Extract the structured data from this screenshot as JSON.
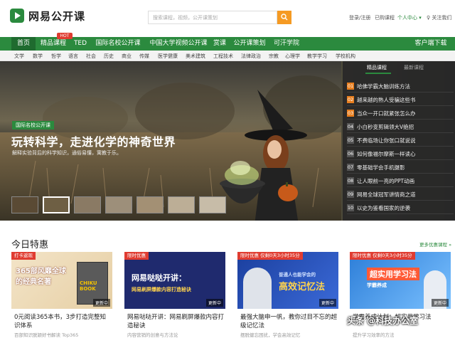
{
  "header": {
    "logo_text": "网易公开课",
    "search_placeholder": "搜索课程，视频，公开课策划",
    "links": [
      "登录/注册",
      "已购课程",
      "个人中心 ▾",
      "关注我们"
    ]
  },
  "nav": {
    "items": [
      "首页",
      "精品课程",
      "TED",
      "国际名校公开课",
      "中国大学视频公开课",
      "赏课",
      "公开课策划",
      "可汗学院"
    ],
    "hot_badge": "HOT",
    "client_download": "客户端下载"
  },
  "subnav": [
    "文学",
    "数学",
    "哲学",
    "语言",
    "社会",
    "历史",
    "商业",
    "传媒",
    "医学健康",
    "美术建筑",
    "工程技术",
    "法律政治",
    "宗教",
    "心理学",
    "教学学习",
    "学校机构"
  ],
  "banner": {
    "tag": "国际名校公开课",
    "title": "玩转科学，走进化学的神奇世界",
    "subtitle": "解释实验背后的科学知识，通俗易懂，寓教于乐。"
  },
  "side": {
    "tabs": [
      "精品课程",
      "最新课程"
    ],
    "items": [
      {
        "num": "01",
        "text": "哈佛学霸大脑训练方法"
      },
      {
        "num": "02",
        "text": "越来越的熟人受骗这些书"
      },
      {
        "num": "03",
        "text": "当众一开口就紧张怎么办"
      },
      {
        "num": "04",
        "text": "小白秒变剪辑领大V绝招"
      },
      {
        "num": "05",
        "text": "不费临场让你张口就说说"
      },
      {
        "num": "06",
        "text": "如何像福尔摩斯一样读心"
      },
      {
        "num": "07",
        "text": "零基础学会手机摄影"
      },
      {
        "num": "08",
        "text": "让人眼前一亮的PPT动画"
      },
      {
        "num": "09",
        "text": "网易全球冠军讲情商之道"
      },
      {
        "num": "10",
        "text": "以史为鉴看国家的逆袭"
      }
    ]
  },
  "today": {
    "title": "今日特惠",
    "more": "更多优惠课程 »",
    "cards": [
      {
        "badge": "打卡返现",
        "img_text": "365部风靡全球的经典名著",
        "img_sub": "CHIKU BOOK",
        "update": "更新中",
        "title": "0元阅读365本书，3步打造完整知识体系",
        "desc": "百部知识脱颖好书解读 Top365"
      },
      {
        "badge": "限时优惠",
        "img_text": "网易哒哒开讲：",
        "img_sub": "网易刷屏爆款内容打造秘诀",
        "update": "更新中",
        "title": "网易哒哒开讲：网易刷屏爆款内容打造秘诀",
        "desc": "内容营销的创意与方法论"
      },
      {
        "badge": "限时优惠 仅剩0天3小时35分",
        "img_text": "高效记忆法",
        "img_sub": "普通人也能学会的",
        "update": "更新中",
        "title": "最强大脑申一帆，教你过目不忘的超级记忆法",
        "desc": "摆脱健忘困扰，学会高效记忆"
      },
      {
        "badge": "限时优惠 仅剩0天3小时35分",
        "img_text": "超实用学习法",
        "img_sub": "学霸养成",
        "update": "更新中",
        "title": "学霸养成计划：超实用学习法",
        "desc": "提升学习效率的方法"
      }
    ]
  },
  "watermark": "头条 @科技办公室"
}
